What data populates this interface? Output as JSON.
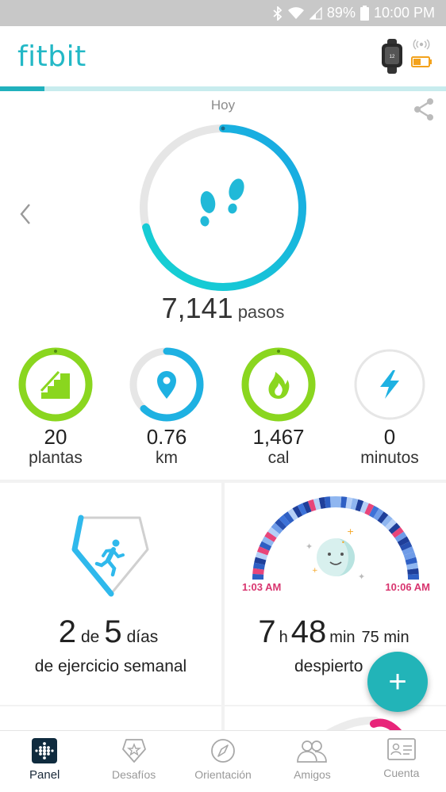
{
  "status_bar": {
    "battery_percent": "89%",
    "time": "10:00 PM"
  },
  "header": {
    "logo_text": "fitbit",
    "sync_progress": 0.1
  },
  "steps": {
    "date_label": "Hoy",
    "value": "7,141",
    "unit": "pasos",
    "goal_progress": 0.71
  },
  "metrics": [
    {
      "value": "20",
      "unit": "plantas",
      "icon": "stairs-icon",
      "progress": 1.0,
      "color": "#8ad61f"
    },
    {
      "value": "0.76",
      "unit": "km",
      "icon": "location-pin-icon",
      "progress": 0.62,
      "color": "#1eb1e2"
    },
    {
      "value": "1,467",
      "unit": "cal",
      "icon": "flame-icon",
      "progress": 1.0,
      "color": "#8ad61f"
    },
    {
      "value": "0",
      "unit": "minutos",
      "icon": "lightning-icon",
      "progress": 0.0,
      "color": "#1eb1e2"
    }
  ],
  "exercise": {
    "done": "2",
    "of_word": "de",
    "goal": "5",
    "days_word": "días",
    "subtitle": "de ejercicio semanal"
  },
  "sleep": {
    "start_time": "1:03 AM",
    "end_time": "10:06 AM",
    "hours": "7",
    "hours_unit": "h",
    "minutes": "48",
    "minutes_unit": "min",
    "awake_value": "75 min",
    "awake_label": "despierto"
  },
  "fab_label": "+",
  "bottom_nav": [
    {
      "label": "Panel",
      "icon": "dashboard-icon",
      "active": true
    },
    {
      "label": "Desafíos",
      "icon": "challenge-badge-icon",
      "active": false
    },
    {
      "label": "Orientación",
      "icon": "compass-icon",
      "active": false
    },
    {
      "label": "Amigos",
      "icon": "friends-icon",
      "active": false
    },
    {
      "label": "Cuenta",
      "icon": "account-card-icon",
      "active": false
    }
  ],
  "colors": {
    "brand": "#23b8c6",
    "steps_ring": "#1eb1e2",
    "goal_green": "#8ad61f",
    "sleep_time": "#d8356f",
    "fab": "#22b4b8"
  }
}
